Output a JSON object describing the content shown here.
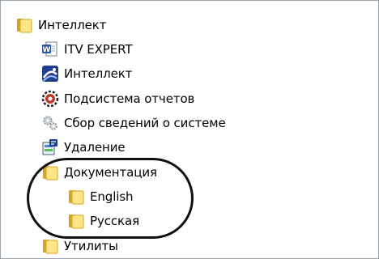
{
  "tree": {
    "root": {
      "label": "Интеллект",
      "icon": "folder-icon"
    },
    "items": [
      {
        "label": "ITV EXPERT",
        "icon": "word-document-icon"
      },
      {
        "label": "Интеллект",
        "icon": "intellect-app-icon"
      },
      {
        "label": "Подсистема отчетов",
        "icon": "report-subsystem-icon"
      },
      {
        "label": "Сбор сведений о системе",
        "icon": "gears-icon"
      },
      {
        "label": "Удаление",
        "icon": "uninstall-icon"
      },
      {
        "label": "Документация",
        "icon": "folder-icon",
        "children": [
          {
            "label": "English",
            "icon": "folder-icon"
          },
          {
            "label": "Русская",
            "icon": "folder-icon"
          }
        ]
      },
      {
        "label": "Утилиты",
        "icon": "folder-icon"
      }
    ]
  },
  "colors": {
    "folder_light": "#ffe58a",
    "folder_dark": "#d9a520",
    "word_blue": "#2b5797",
    "report_red": "#c0392b"
  }
}
